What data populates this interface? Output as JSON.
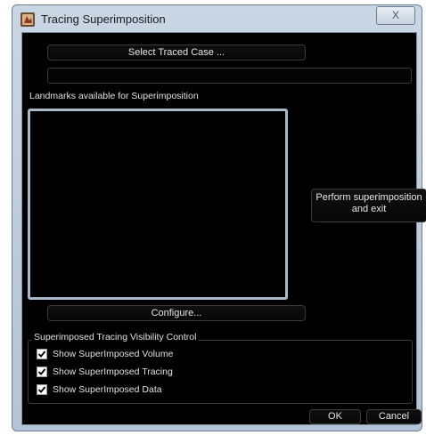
{
  "window": {
    "title": "Tracing Superimposition",
    "close_label": "X"
  },
  "buttons": {
    "select_traced_case": "Select Traced Case ...",
    "perform_line1": "Perform superimposition",
    "perform_line2": "and exit",
    "configure": "Configure...",
    "ok": "OK",
    "cancel": "Cancel"
  },
  "case_path_value": "",
  "landmarks": {
    "label": "Landmarks available for Superimposition",
    "items": []
  },
  "visibility_group": {
    "title": "Superimposed Tracing Visibility Control",
    "checkboxes": [
      {
        "label": "Show SuperImposed Volume",
        "checked": true
      },
      {
        "label": "Show SuperImposed Tracing",
        "checked": true
      },
      {
        "label": "Show SuperImposed Data",
        "checked": true
      }
    ]
  },
  "colors": {
    "client_background": "#000000",
    "frame": "#c9d6e4",
    "listbox_border": "#aab9c9"
  },
  "icons": {
    "app": "app-icon",
    "close": "close-icon",
    "check": "check-icon"
  }
}
